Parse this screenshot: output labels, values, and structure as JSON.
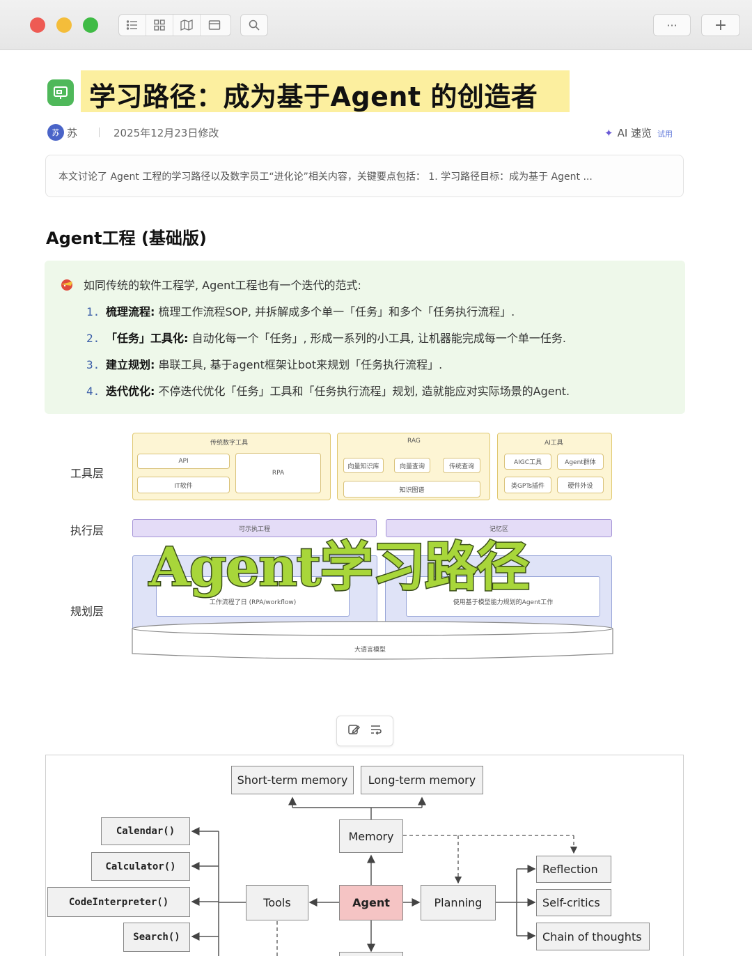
{
  "toolbar": {
    "icons": [
      "list-icon",
      "grid-icon",
      "map-icon",
      "window-icon",
      "search-icon",
      "more-icon",
      "plus-icon"
    ],
    "more_label": "···",
    "add_label": "+"
  },
  "doc": {
    "title": "学习路径：成为基于Agent 的创造者",
    "author_initial": "苏",
    "author": "苏",
    "modified": "2025年12月23日修改",
    "ai_read": "AI 速览",
    "ai_trial": "试用",
    "summary": "本文讨论了 Agent 工程的学习路径以及数字员工“进化论”相关内容，关键要点包括： 1. 学习路径目标：成为基于 Agent ..."
  },
  "section": {
    "heading": "Agent工程 (基础版)",
    "intro": "如同传统的软件工程学, Agent工程也有一个迭代的范式:",
    "steps": [
      {
        "num": "1.",
        "bold": "梳理流程:",
        "text": " 梳理工作流程SOP, 并拆解成多个单一「任务」和多个「任务执行流程」."
      },
      {
        "num": "2.",
        "bold": "「任务」工具化:",
        "text": " 自动化每一个「任务」, 形成一系列的小工具, 让机器能完成每一个单一任务."
      },
      {
        "num": "3.",
        "bold": "建立规划:",
        "text": " 串联工具, 基于agent框架让bot来规划「任务执行流程」."
      },
      {
        "num": "4.",
        "bold": "迭代优化:",
        "text": " 不停迭代优化「任务」工具和「任务执行流程」规划, 造就能应对实际场景的Agent."
      }
    ]
  },
  "layer_diagram": {
    "labels": {
      "tools": "工具层",
      "exec": "执行层",
      "plan": "规划层"
    },
    "group1": {
      "title": "传统数字工具",
      "api": "API",
      "it": "IT软件",
      "rpa": "RPA"
    },
    "group2": {
      "title": "RAG",
      "a": "向量知识库",
      "b": "向量查询",
      "c": "传统查询",
      "d": "知识图谱"
    },
    "group3": {
      "title": "AI工具",
      "a": "AIGC工具",
      "b": "Agent群体",
      "c": "类GPTs插件",
      "d": "硬件外设"
    },
    "exec_left": "可示执工程",
    "exec_right": "记忆区",
    "plan_left": "工作流程了日 (RPA/workflow)",
    "plan_right": "使用基于模型能力规划的Agent工作",
    "base": "大语言模型",
    "overlay": "Agent学习路径"
  },
  "agent_diagram": {
    "short_term": "Short-term memory",
    "long_term": "Long-term memory",
    "memory": "Memory",
    "calendar": "Calendar()",
    "calculator": "Calculator()",
    "code_interpreter": "CodeInterpreter()",
    "search": "Search()",
    "tools": "Tools",
    "agent": "Agent",
    "planning": "Planning",
    "reflection": "Reflection",
    "self_critics": "Self-critics",
    "chain": "Chain of thoughts"
  }
}
